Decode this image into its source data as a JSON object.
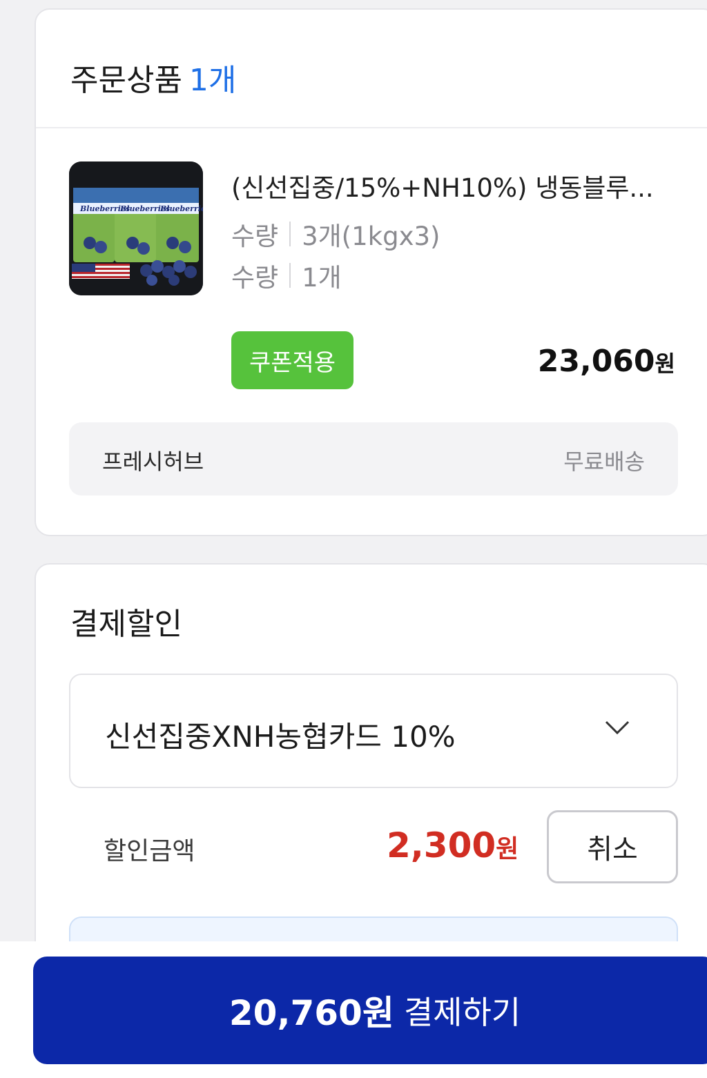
{
  "order": {
    "title": "주문상품",
    "count": "1개",
    "product": {
      "name": "(신선집중/15%+NH10%) 냉동블루...",
      "options": [
        {
          "label": "수량",
          "value": "3개(1kgx3)"
        },
        {
          "label": "수량",
          "value": "1개"
        }
      ],
      "coupon_button": "쿠폰적용",
      "price_number": "23,060",
      "price_unit": "원",
      "thumbnail_text": "Blueberries"
    },
    "seller": {
      "name": "프레시허브",
      "shipping": "무료배송"
    }
  },
  "discount": {
    "title": "결제할인",
    "selected_card": "신선집중XNH농협카드 10%",
    "amount_label": "할인금액",
    "amount_number": "2,300",
    "amount_unit": "원",
    "cancel_button": "취소"
  },
  "checkout": {
    "amount": "20,760원",
    "label": "결제하기"
  },
  "colors": {
    "accent_blue": "#1e6fe6",
    "coupon_green": "#56c23c",
    "discount_red": "#d12d22",
    "pay_button": "#0c28a8"
  }
}
